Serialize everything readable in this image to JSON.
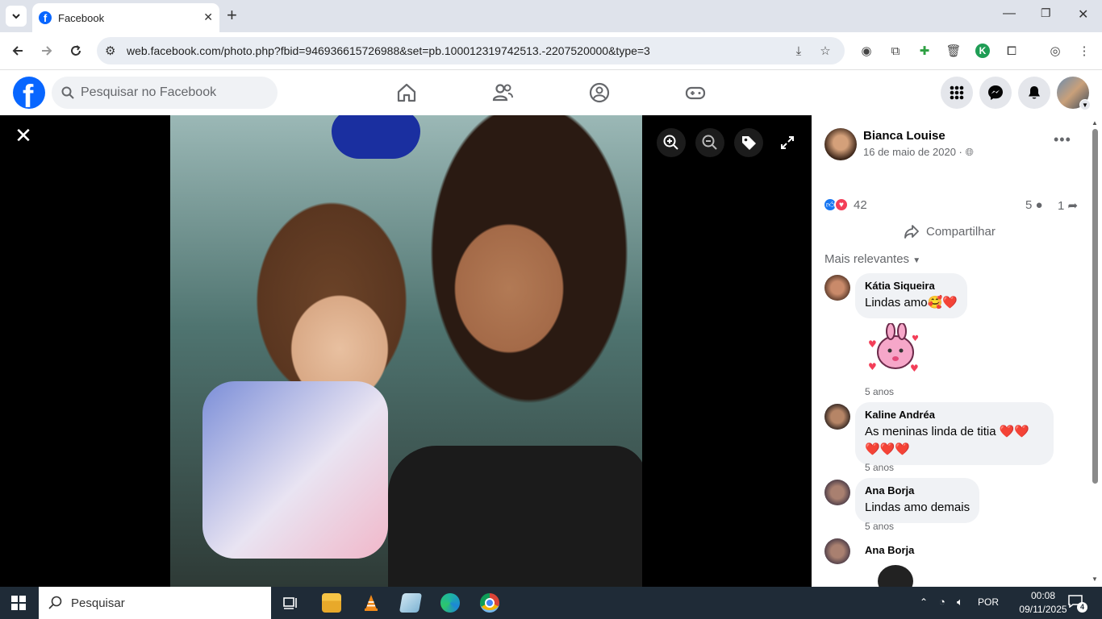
{
  "browser": {
    "tab_title": "Facebook",
    "url": "web.facebook.com/photo.php?fbid=946936615726988&set=pb.100012319742513.-2207520000&type=3"
  },
  "fb": {
    "search_placeholder": "Pesquisar no Facebook"
  },
  "post": {
    "author": "Bianca Louise",
    "date": "16 de maio de 2020 ·",
    "reactions_count": "42",
    "comments_count": "5",
    "shares_count": "1",
    "share_label": "Compartilhar",
    "sort_label": "Mais relevantes"
  },
  "comments": [
    {
      "name": "Kátia Siqueira",
      "text": "Lindas amo🥰❤️",
      "time": ""
    },
    {
      "name": "",
      "text": "",
      "time": "5 anos"
    },
    {
      "name": "Kaline Andréa",
      "text": "As meninas linda de titia ❤️❤️❤️❤️❤️",
      "time": "5 anos"
    },
    {
      "name": "Ana Borja",
      "text": "Lindas amo demais",
      "time": "5 anos"
    },
    {
      "name": "Ana Borja",
      "text": "",
      "time": ""
    }
  ],
  "taskbar": {
    "search_label": "Pesquisar",
    "lang": "POR",
    "time": "00:08",
    "date": "09/11/2025",
    "notifications": "4"
  },
  "colors": {
    "fb_blue": "#0866ff",
    "like_blue": "#1877f2",
    "love_red": "#f33e58"
  }
}
